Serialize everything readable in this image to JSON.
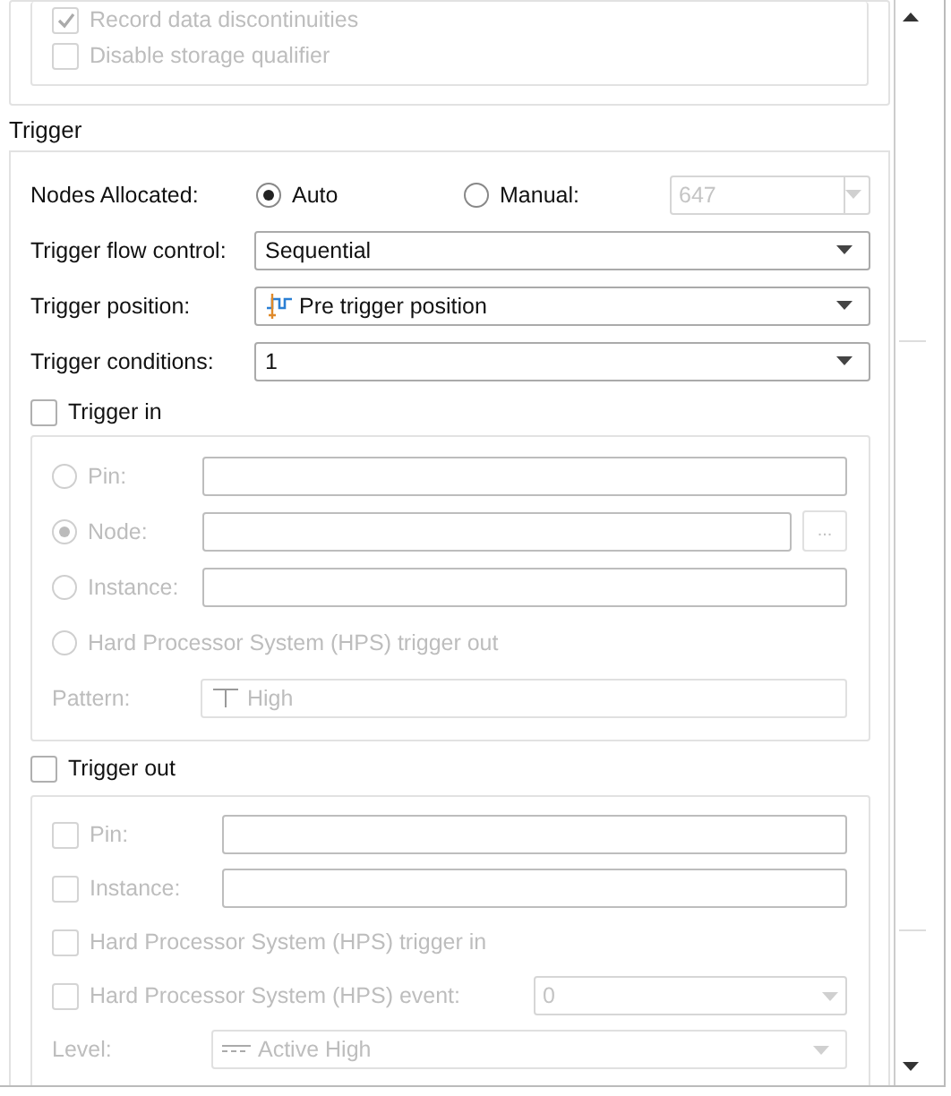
{
  "storage": {
    "options": [
      {
        "label": "Record data discontinuities",
        "checked": true
      },
      {
        "label": "Disable storage qualifier",
        "checked": false
      }
    ]
  },
  "trigger": {
    "title": "Trigger",
    "nodes_allocated": {
      "label": "Nodes Allocated:",
      "value": "647",
      "options": [
        {
          "label": "Auto",
          "selected": true
        },
        {
          "label": "Manual:",
          "selected": false
        }
      ]
    },
    "dropdowns": [
      {
        "label": "Trigger flow control:",
        "value": "Sequential",
        "icon": false
      },
      {
        "label": "Trigger position:",
        "value": "Pre trigger position",
        "icon": true
      },
      {
        "label": "Trigger conditions:",
        "value": "1",
        "icon": false
      }
    ],
    "trigger_in": {
      "label": "Trigger in",
      "checked": false,
      "browse": "...",
      "options": [
        {
          "label": "Pin:",
          "selected": false,
          "kind": "field"
        },
        {
          "label": "Node:",
          "selected": true,
          "kind": "browse"
        },
        {
          "label": "Instance:",
          "selected": false,
          "kind": "field"
        },
        {
          "label": "Hard Processor System (HPS) trigger out",
          "selected": false,
          "kind": "plain"
        }
      ],
      "pattern": {
        "label": "Pattern:",
        "value": "High"
      }
    },
    "trigger_out": {
      "label": "Trigger out",
      "checked": false,
      "options": [
        {
          "label": "Pin:",
          "checked": false,
          "kind": "field"
        },
        {
          "label": "Instance:",
          "checked": false,
          "kind": "field"
        },
        {
          "label": "Hard Processor System (HPS) trigger in",
          "checked": false,
          "kind": "plain"
        },
        {
          "label": "Hard Processor System (HPS) event:",
          "checked": false,
          "kind": "spin",
          "value": "0"
        }
      ],
      "level": {
        "label": "Level:",
        "value": "Active High"
      }
    }
  }
}
